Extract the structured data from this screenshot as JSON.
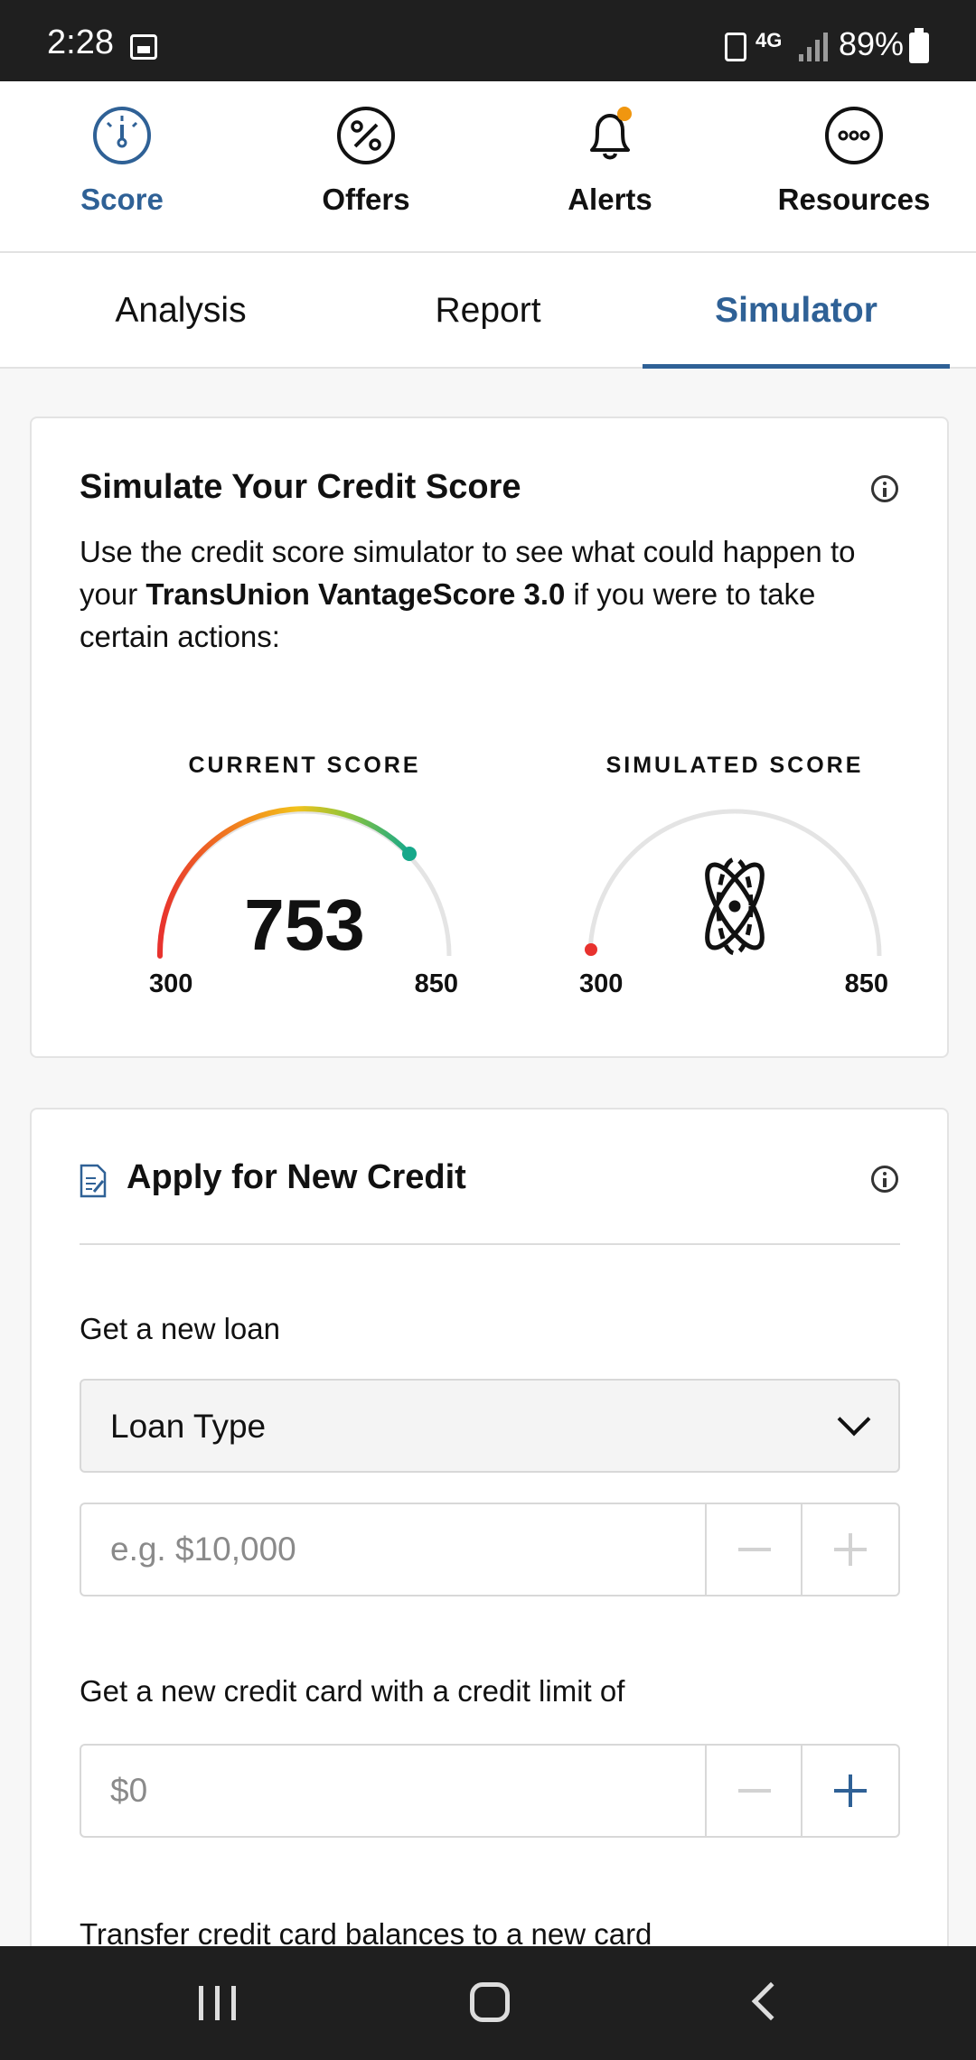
{
  "status_bar": {
    "time": "2:28",
    "network": "4G",
    "battery": "89%"
  },
  "top_nav": [
    {
      "label": "Score",
      "icon": "gauge-icon",
      "active": true
    },
    {
      "label": "Offers",
      "icon": "percent-icon",
      "active": false
    },
    {
      "label": "Alerts",
      "icon": "bell-icon",
      "active": false
    },
    {
      "label": "Resources",
      "icon": "more-icon",
      "active": false
    }
  ],
  "tabs": [
    {
      "label": "Analysis"
    },
    {
      "label": "Report"
    },
    {
      "label": "Simulator",
      "active": true
    }
  ],
  "simulator": {
    "title": "Simulate Your Credit Score",
    "desc_1": "Use the credit score simulator to see what could happen to your ",
    "desc_bold": "TransUnion VantageScore 3.0",
    "desc_2": " if you were to take certain actions:",
    "current": {
      "label": "CURRENT SCORE",
      "score": "753",
      "min": "300",
      "max": "850",
      "value": 753
    },
    "simulated": {
      "label": "SIMULATED SCORE",
      "min": "300",
      "max": "850",
      "icon": "atom-icon"
    }
  },
  "apply_credit": {
    "title": "Apply for New Credit",
    "loan_label": "Get a new loan",
    "loan_type": "Loan Type",
    "loan_amount_placeholder": "e.g. $10,000",
    "card_label": "Get a new credit card with a credit limit of",
    "card_limit_placeholder": "$0",
    "transfer_label": "Transfer credit card balances to a new card"
  },
  "colors": {
    "accent": "#2f6196",
    "alert_dot": "#f0960f"
  }
}
